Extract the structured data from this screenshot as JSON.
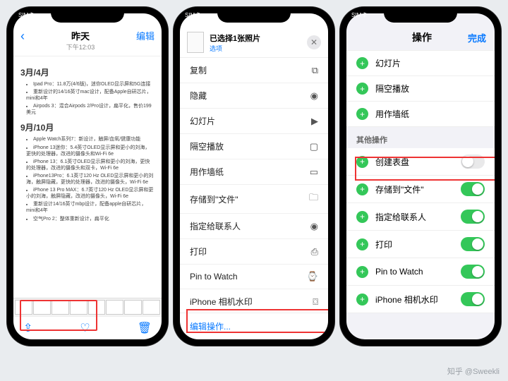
{
  "status_sim": "SIM卡",
  "p1": {
    "title": "昨天",
    "subtitle": "下午12:03",
    "edit": "编辑",
    "sec1": "3月/4月",
    "sec1_items": [
      "Ipad Pro：11.8万(4/6版)，迷你OLED显示屏和5G连接",
      "重新设计的14/16英寸mac设计，配备Apple自研芯片，mini和4年",
      "Airpods 3：混合Airpods 2/Pro设计，扁平化，售价199美元"
    ],
    "sec2": "9月/10月",
    "sec2_items": [
      "Apple Watch系列7：新设计，触屏/血氧/健康功能",
      "iPhone 13迷你：5.4英寸OLED显示屏和更小的刘海，更快的处理器，改进的摄像头和Wi-Fi 6e",
      "iPhone 13：6.1英寸OLED显示屏和更小的刘海，更快的处理器，改进的摄像头和双卡，Wi-Fi 6e",
      "iPhone13Pro：6.1英寸120 Hz OLED显示屏和更小的刘海，触屏隐藏，更快的处理器，改进的摄像头，Wi-Fi 6e",
      "iPhone 13 Pro MAX：6.7英寸120 Hz OLED显示屏和更小的刘海，触屏隐藏，改进的摄像头，Wi-Fi 6e",
      "重新设计14/16英寸mbp设计，配备apple自研芯片，mini和4年",
      "空气Pro 2：整体重新设计，扁平化"
    ]
  },
  "p2": {
    "selected": "已选择1张照片",
    "options": "选项",
    "items": [
      {
        "label": "复制",
        "icon": "⧉"
      },
      {
        "label": "隐藏",
        "icon": "◉"
      },
      {
        "label": "幻灯片",
        "icon": "▶"
      },
      {
        "label": "隔空播放",
        "icon": "▢"
      },
      {
        "label": "用作墙纸",
        "icon": "▭"
      },
      {
        "label": "存储到\"文件\"",
        "icon": "🗀"
      },
      {
        "label": "指定给联系人",
        "icon": "◉"
      },
      {
        "label": "打印",
        "icon": "⎙"
      },
      {
        "label": "Pin to Watch",
        "icon": "⌚"
      },
      {
        "label": "iPhone 相机水印",
        "icon": "⌼"
      }
    ],
    "edit_ops": "编辑操作..."
  },
  "p3": {
    "title": "操作",
    "done": "完成",
    "top": [
      "幻灯片",
      "隔空播放",
      "用作墙纸"
    ],
    "other_h": "其他操作",
    "other": [
      {
        "label": "创建表盘",
        "on": false
      },
      {
        "label": "存储到\"文件\"",
        "on": true
      },
      {
        "label": "指定给联系人",
        "on": true
      },
      {
        "label": "打印",
        "on": true
      },
      {
        "label": "Pin to Watch",
        "on": true
      },
      {
        "label": "iPhone 相机水印",
        "on": true
      }
    ]
  },
  "watermark": "知乎 @Sweekli"
}
